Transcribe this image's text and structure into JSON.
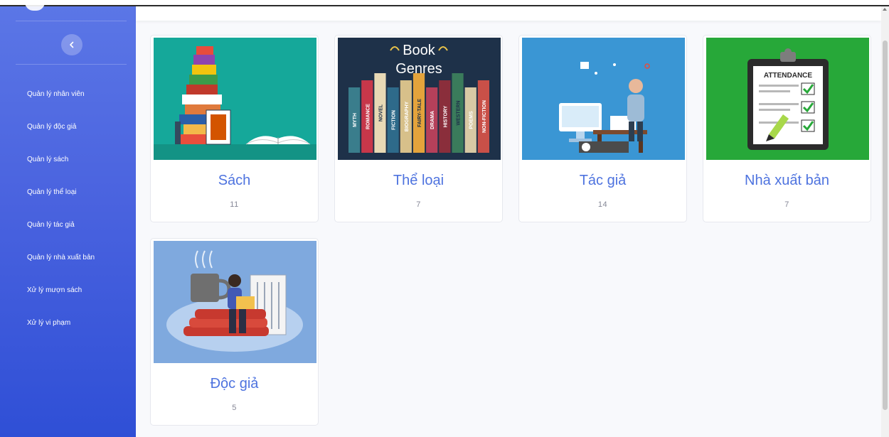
{
  "sidebar": {
    "items": [
      {
        "label": "Quản lý nhân viên"
      },
      {
        "label": "Quản lý độc giả"
      },
      {
        "label": "Quản lý sách"
      },
      {
        "label": "Quản lý thể loại"
      },
      {
        "label": "Quản lý tác giả"
      },
      {
        "label": "Quản lý nhà xuất bản"
      },
      {
        "label": "Xử lý mượn sách"
      },
      {
        "label": "Xử lý vi phạm"
      }
    ],
    "toggle_icon": "chevron-left-icon"
  },
  "cards": [
    {
      "title": "Sách",
      "count": "11",
      "image": "stacked-books-illustration"
    },
    {
      "title": "Thể loại",
      "count": "7",
      "image": "book-genres-illustration"
    },
    {
      "title": "Tác giả",
      "count": "14",
      "image": "author-at-desk-illustration"
    },
    {
      "title": "Nhà xuất bản",
      "count": "7",
      "image": "attendance-clipboard-illustration"
    },
    {
      "title": "Độc giả",
      "count": "5",
      "image": "reader-with-books-illustration"
    }
  ],
  "illustrations": {
    "genres": {
      "heading_line1": "Book",
      "heading_line2": "Genres",
      "spines": [
        "MYTH",
        "ROMANCE",
        "NOVEL",
        "FICTION",
        "BIOGRAPHY",
        "FAIRY-TALE",
        "DRAMA",
        "HISTORY",
        "WESTERN",
        "POEMS",
        "NON-FICTION"
      ]
    },
    "attendance_label": "ATTENDANCE"
  },
  "colors": {
    "sidebar_top": "#5b76e6",
    "sidebar_bottom": "#2f4fd6",
    "accent_title": "#4e73df",
    "count_text": "#858796",
    "card1_bg": "#15a89a",
    "card2_bg": "#1e3149",
    "card3_bg": "#3a96d4",
    "card4_bg": "#27a839",
    "card5_bg": "#7fa9de"
  }
}
